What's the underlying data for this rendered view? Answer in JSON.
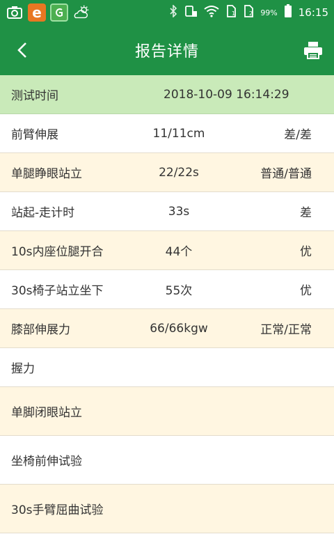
{
  "status_bar": {
    "battery": "99%",
    "time": "16:15",
    "icons": [
      "camera-icon",
      "app-e-icon",
      "app-g-icon",
      "weather-icon",
      "bluetooth-icon",
      "vibrate-icon",
      "wifi-icon",
      "sim1-icon",
      "sim2-icon",
      "battery-icon"
    ]
  },
  "app_bar": {
    "title": "报告详情",
    "back_icon": "chevron-left-icon",
    "print_icon": "printer-icon",
    "color": "#1f9145"
  },
  "header": {
    "label": "测试时间",
    "value": "2018-10-09 16:14:29",
    "color": "#c9eab9"
  },
  "rows": [
    {
      "name": "前臂伸展",
      "value": "11/11cm",
      "grade": "差/差"
    },
    {
      "name": "单腿睁眼站立",
      "value": "22/22s",
      "grade": "普通/普通"
    },
    {
      "name": "站起-走计时",
      "value": "33s",
      "grade": "差"
    },
    {
      "name": "10s内座位腿开合",
      "value": "44个",
      "grade": "优"
    },
    {
      "name": "30s椅子站立坐下",
      "value": "55次",
      "grade": "优"
    },
    {
      "name": "膝部伸展力",
      "value": "66/66kgw",
      "grade": "正常/正常"
    },
    {
      "name": "握力",
      "value": "",
      "grade": ""
    },
    {
      "name": "单脚闭眼站立",
      "value": "",
      "grade": ""
    },
    {
      "name": "坐椅前伸试验",
      "value": "",
      "grade": ""
    },
    {
      "name": "30s手臂屈曲试验",
      "value": "",
      "grade": ""
    }
  ],
  "row_colors": {
    "odd": "#ffffff",
    "even": "#fff6e1"
  }
}
